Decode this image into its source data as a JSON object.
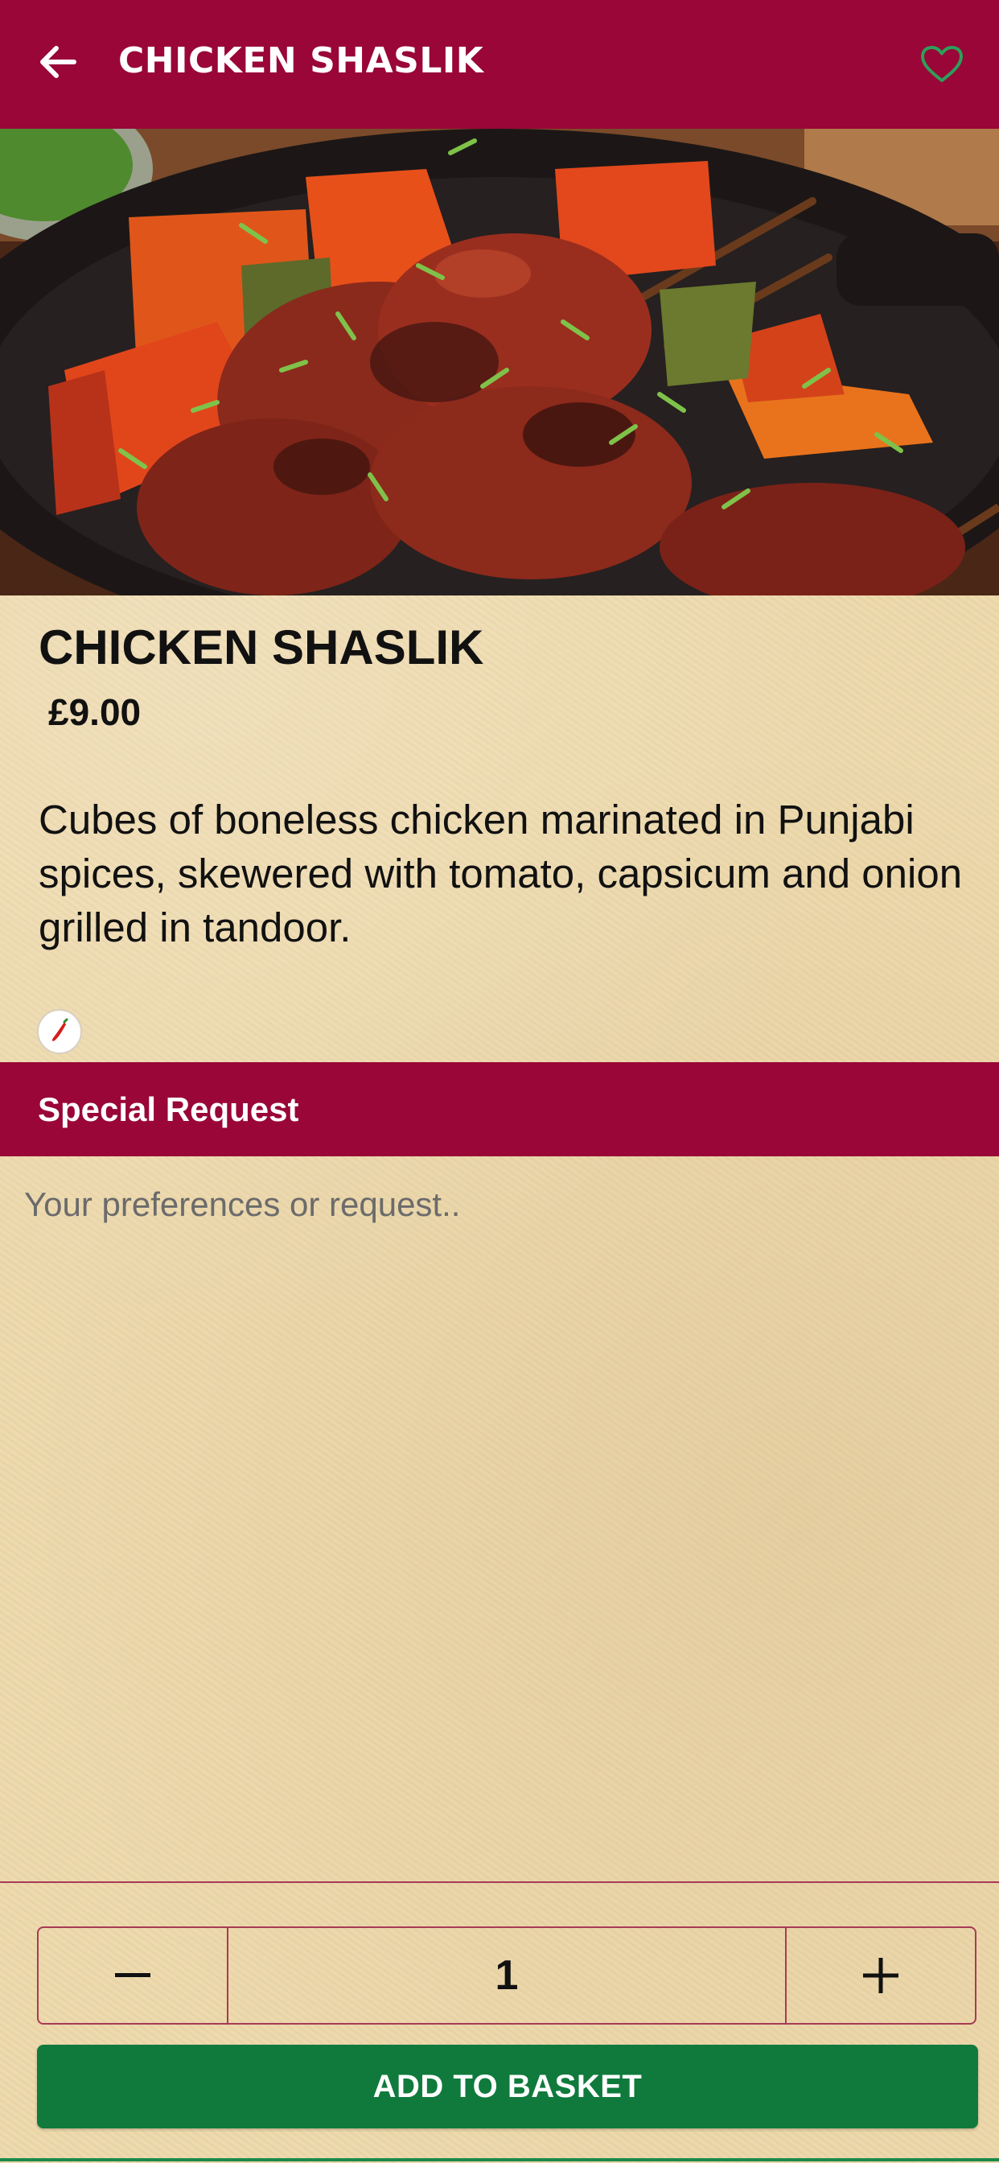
{
  "header": {
    "title": "CHICKEN SHASLIK",
    "back_icon": "arrow-left-icon",
    "favorite_icon": "heart-outline-icon"
  },
  "hero": {
    "image": "chicken-shaslik-photo"
  },
  "item": {
    "name": "CHICKEN SHASLIK",
    "price": "£9.00",
    "description": "Cubes of boneless chicken marinated in Punjabi spices, skewered with tomato, capsicum and onion grilled in tandoor.",
    "spice_icon": "chili-pepper-icon"
  },
  "special_request": {
    "label": "Special Request",
    "placeholder": "Your preferences or request..",
    "value": ""
  },
  "quantity": {
    "minus_icon": "minus-icon",
    "value": "1",
    "plus_icon": "plus-icon"
  },
  "basket": {
    "add_label": "ADD TO BASKET"
  },
  "colors": {
    "brand": "#990637",
    "favorite_icon": "#2e9e5b",
    "add_button": "#0f7a3c",
    "background": "#ecd8ab"
  }
}
